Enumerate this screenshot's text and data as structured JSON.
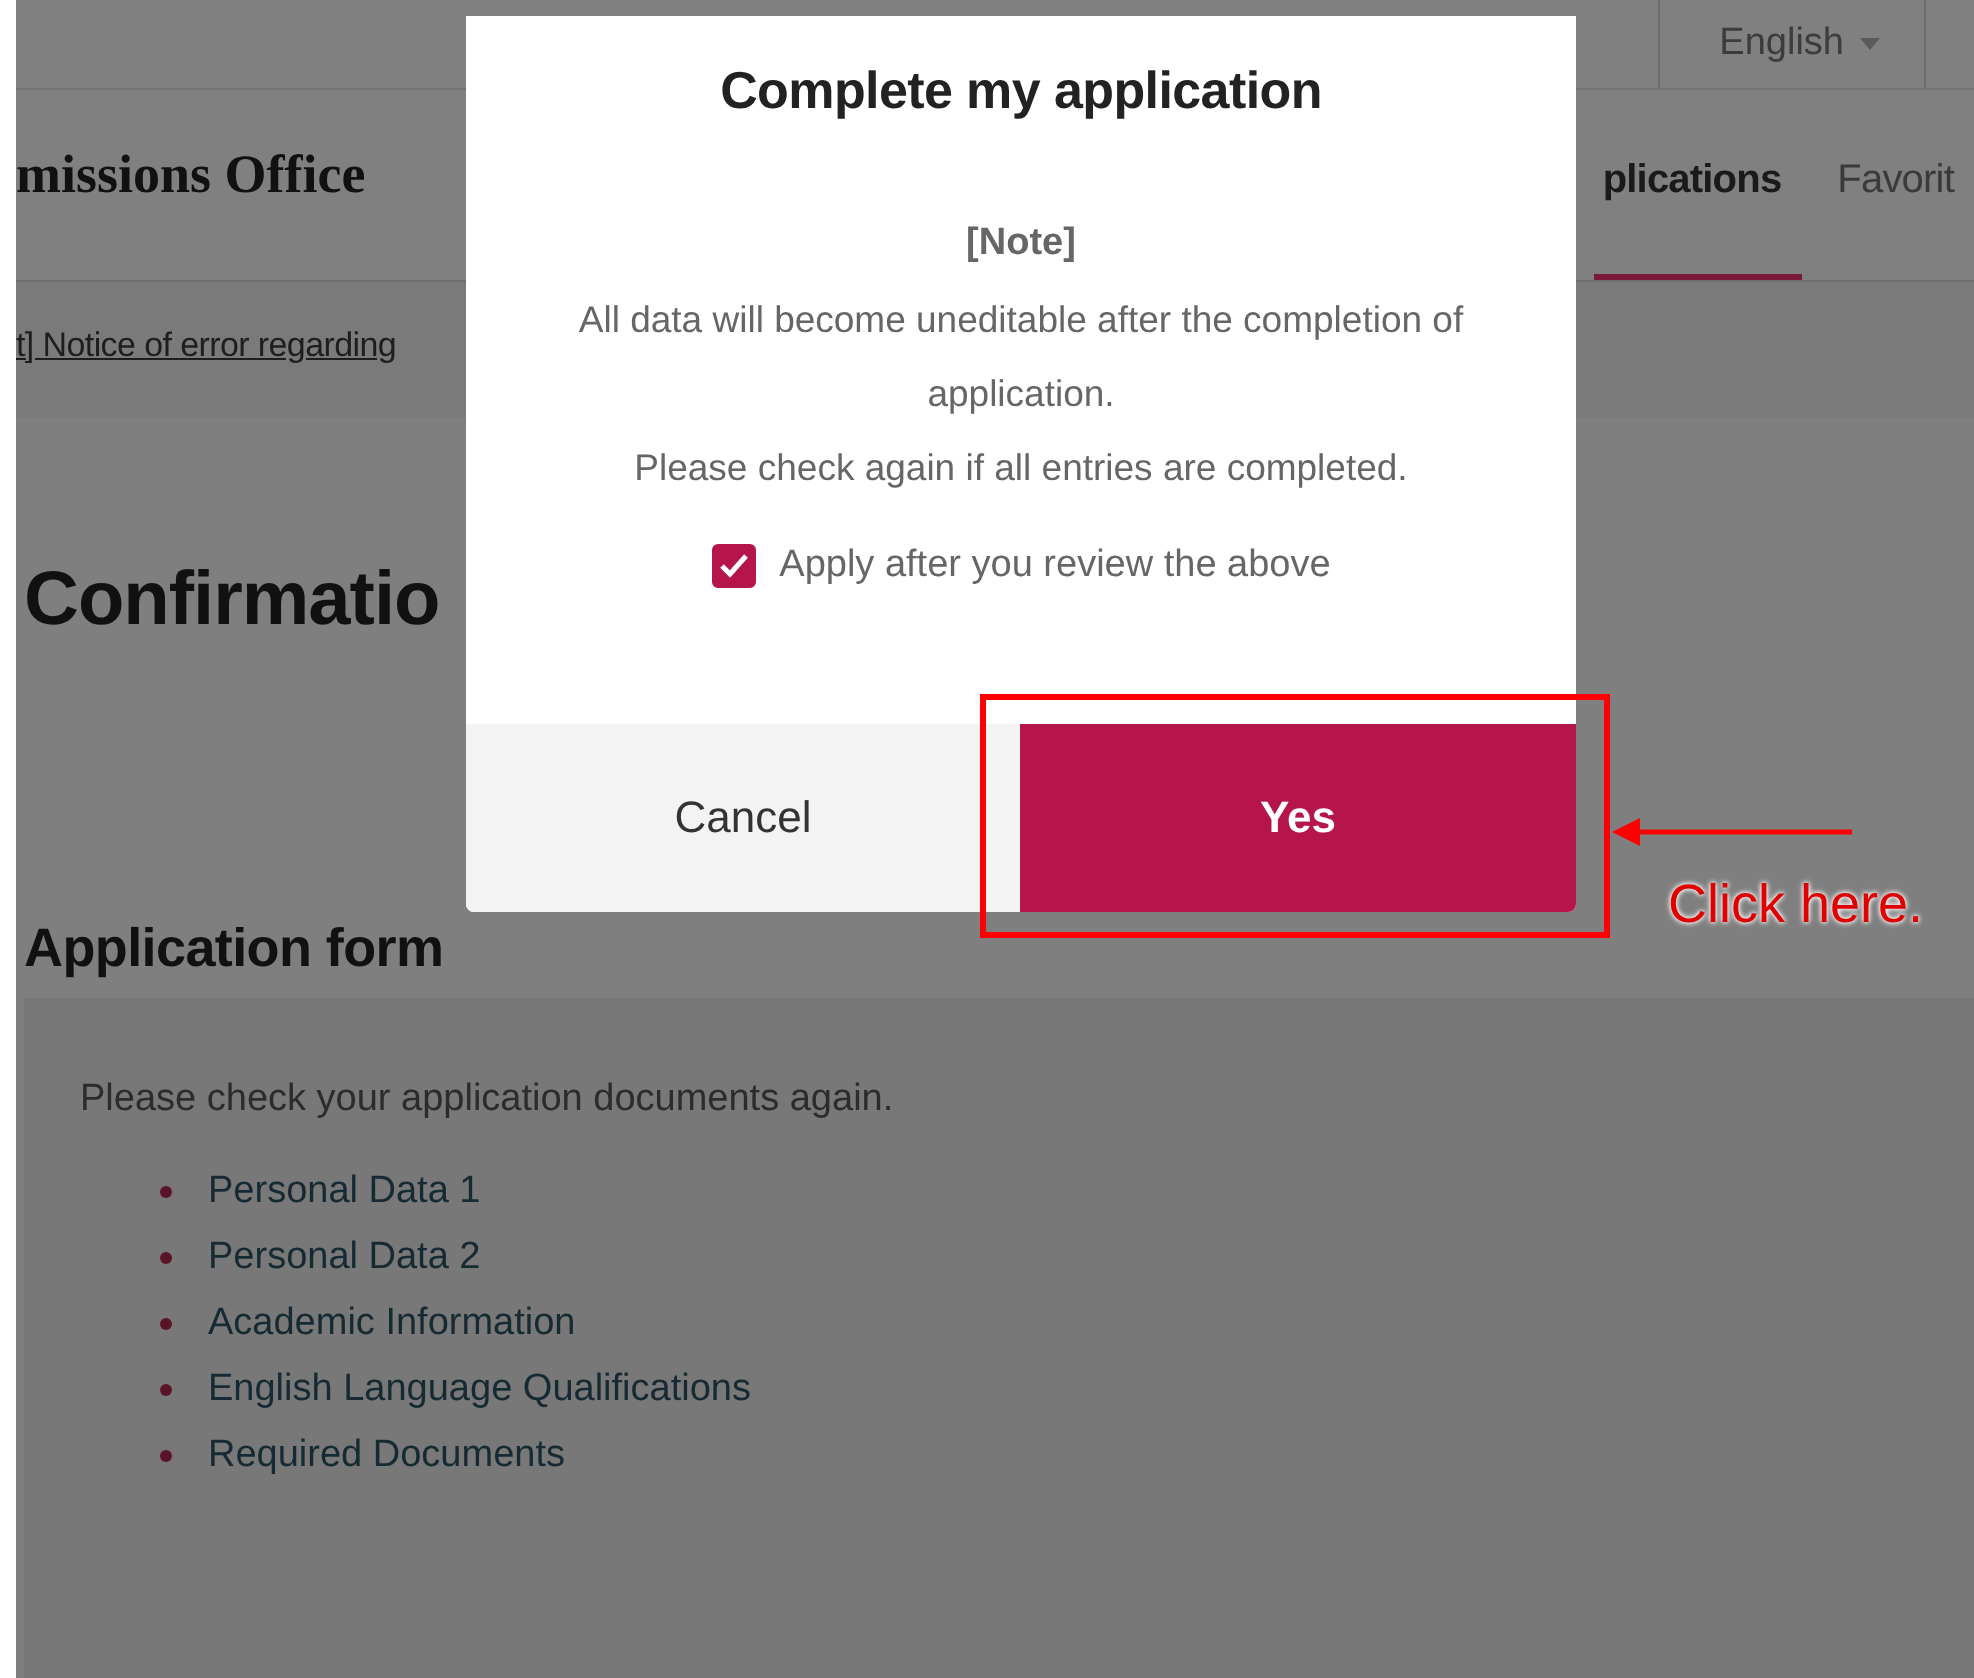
{
  "top_bar": {
    "language": "English"
  },
  "header": {
    "logo_title": "missions Office",
    "nav": [
      {
        "label": "plications",
        "selected": true
      },
      {
        "label": "Favorit",
        "selected": false
      }
    ]
  },
  "notice": {
    "link": "t] Notice of error regarding"
  },
  "page_title": "Confirmatio",
  "section": {
    "title": "Application form",
    "intro": "Please check your application documents again.",
    "items": [
      "Personal Data 1",
      "Personal Data 2",
      "Academic Information",
      "English Language Qualifications",
      "Required Documents"
    ]
  },
  "modal": {
    "title": "Complete my application",
    "note_heading": "[Note]",
    "note_lines": [
      "All data will become uneditable after the completion of application.",
      "Please check again if all entries are completed."
    ],
    "checkbox": {
      "label": "Apply after you review the above",
      "checked": true
    },
    "buttons": [
      {
        "kind": "cancel",
        "label": "Cancel"
      },
      {
        "kind": "confirm",
        "label": "Yes"
      }
    ]
  },
  "annotation": {
    "text": "Click here."
  }
}
